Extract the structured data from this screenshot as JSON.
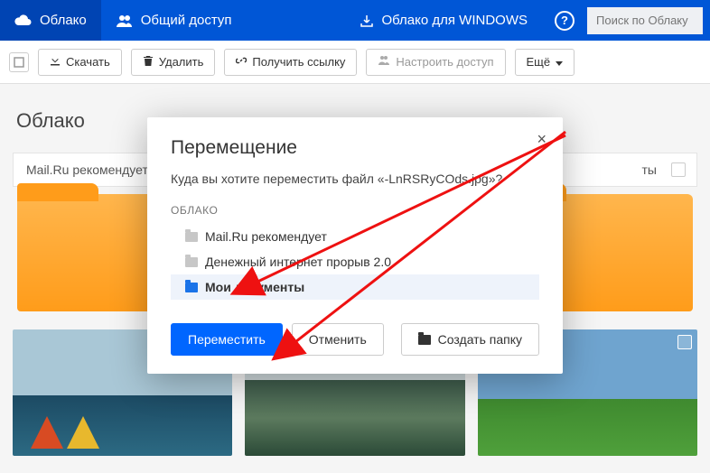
{
  "nav": {
    "cloud": "Облако",
    "shared": "Общий доступ",
    "windows": "Облако для WINDOWS",
    "search_placeholder": "Поиск по Облаку"
  },
  "toolbar": {
    "download": "Скачать",
    "delete": "Удалить",
    "link": "Получить ссылку",
    "access": "Настроить доступ",
    "more": "Ещё"
  },
  "page": {
    "title": "Облако",
    "recommend": "Mail.Ru рекомендует",
    "recommend_suffix": "ты"
  },
  "modal": {
    "title": "Перемещение",
    "subtitle_prefix": "Куда вы хотите переместить файл «",
    "filename": "-LnRSRyCOds.jpg",
    "subtitle_suffix": "»?",
    "tree_header": "ОБЛАКО",
    "items": [
      "Mail.Ru рекомендует",
      "Денежный интернет прорыв 2.0",
      "Мои документы"
    ],
    "move": "Переместить",
    "cancel": "Отменить",
    "newfolder": "Создать папку"
  }
}
